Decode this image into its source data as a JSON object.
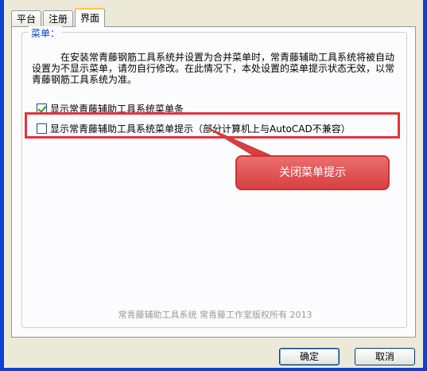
{
  "tabs": [
    {
      "label": "平台",
      "active": false
    },
    {
      "label": "注册",
      "active": false
    },
    {
      "label": "界面",
      "active": true
    }
  ],
  "menu_group": {
    "legend": "菜单：",
    "description": "在安装常青藤钢筋工具系统并设置为合并菜单时，常青藤辅助工具系统将被自动设置为不显示菜单，请勿自行修改。在此情况下，本处设置的菜单提示状态无效，以常青藤钢筋工具系统为准。",
    "show_menubar": {
      "label": "显示常青藤辅助工具系统菜单条",
      "checked": true
    },
    "show_menu_tips": {
      "label": "显示常青藤辅助工具系统菜单提示（部分计算机上与AutoCAD不兼容）",
      "checked": false
    }
  },
  "annotation": {
    "callout_text": "关闭菜单提示",
    "color": "#e8313b"
  },
  "footer": {
    "copyright": "常青藤辅助工具系统 常青藤工作室版权所有 2013"
  },
  "buttons": {
    "ok_label": "确定",
    "cancel_label": "取消"
  },
  "colors": {
    "legend": "#0046d5",
    "frame": "#0a42d6",
    "tab_accent": "#ffc83c"
  }
}
